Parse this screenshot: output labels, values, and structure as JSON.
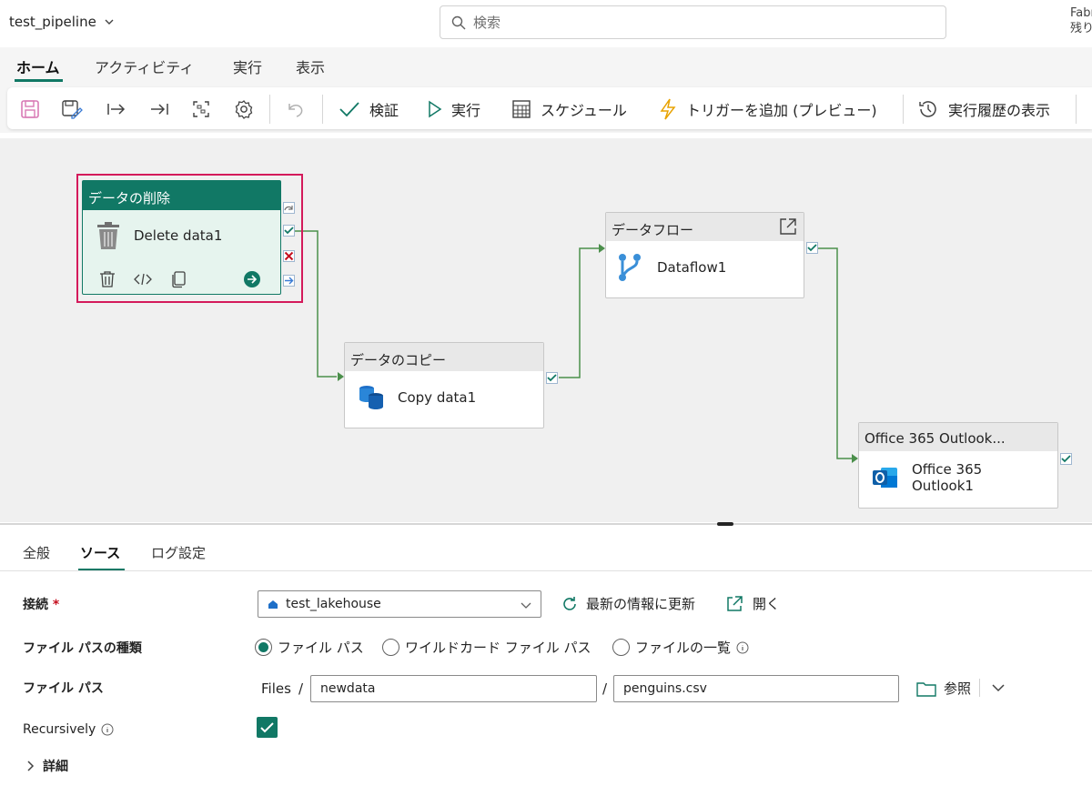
{
  "header": {
    "pipeline_name": "test_pipeline",
    "search_placeholder": "検索",
    "fabric_line1": "Fabr",
    "fabric_line2": "残り"
  },
  "menu_tabs": [
    {
      "label": "ホーム"
    },
    {
      "label": "アクティビティ"
    },
    {
      "label": "実行"
    },
    {
      "label": "表示"
    }
  ],
  "toolbar": {
    "validate": "検証",
    "run": "実行",
    "schedule": "スケジュール",
    "trigger": "トリガーを追加 (プレビュー)",
    "history": "実行履歴の表示"
  },
  "activities": {
    "delete": {
      "title": "データの削除",
      "name": "Delete data1"
    },
    "copy": {
      "title": "データのコピー",
      "name": "Copy data1"
    },
    "dataflow": {
      "title": "データフロー",
      "name": "Dataflow1"
    },
    "outlook": {
      "title": "Office 365 Outlook...",
      "name_line1": "Office 365",
      "name_line2": "Outlook1"
    }
  },
  "bottom_tabs": [
    {
      "label": "全般"
    },
    {
      "label": "ソース"
    },
    {
      "label": "ログ設定"
    }
  ],
  "form": {
    "connection_label": "接続",
    "required_mark": "*",
    "connection_value": "test_lakehouse",
    "refresh": "最新の情報に更新",
    "open": "開く",
    "filepath_type_label": "ファイル パスの種類",
    "radio_filepath": "ファイル パス",
    "radio_wildcard": "ワイルドカード ファイル パス",
    "radio_list": "ファイルの一覧",
    "filepath_label": "ファイル パス",
    "files_prefix": "Files",
    "slash": "/",
    "folder": "newdata",
    "file": "penguins.csv",
    "browse": "参照",
    "recursive_label": "Recursively",
    "details": "詳細"
  },
  "colors": {
    "accent": "#117865",
    "selection": "#d41a5b",
    "success": "#117865",
    "error": "#c50f1f"
  }
}
